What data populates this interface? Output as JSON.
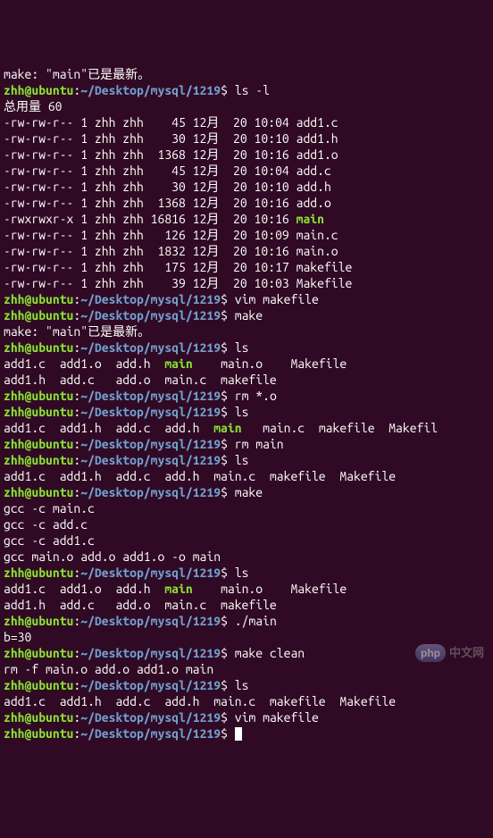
{
  "prompt": {
    "user": "zhh",
    "host": "ubuntu",
    "path": "~/Desktop/mysql/1219"
  },
  "text": {
    "make_uptodate": "make: \"main\"已是最新。",
    "total": "总用量 60"
  },
  "cmds": {
    "ls_l": "ls -l",
    "vim_makefile": "vim makefile",
    "make": "make",
    "ls": "ls",
    "rm_o": "rm *.o",
    "rm_main": "rm main",
    "run_main": "./main",
    "make_clean": "make clean"
  },
  "ls_l_rows": [
    {
      "perm": "-rw-rw-r--",
      "links": "1",
      "owner": "zhh",
      "group": "zhh",
      "size": "45",
      "month": "12月",
      "day": "20",
      "time": "10:04",
      "name": "add1.c",
      "exec": false
    },
    {
      "perm": "-rw-rw-r--",
      "links": "1",
      "owner": "zhh",
      "group": "zhh",
      "size": "30",
      "month": "12月",
      "day": "20",
      "time": "10:10",
      "name": "add1.h",
      "exec": false
    },
    {
      "perm": "-rw-rw-r--",
      "links": "1",
      "owner": "zhh",
      "group": "zhh",
      "size": "1368",
      "month": "12月",
      "day": "20",
      "time": "10:16",
      "name": "add1.o",
      "exec": false
    },
    {
      "perm": "-rw-rw-r--",
      "links": "1",
      "owner": "zhh",
      "group": "zhh",
      "size": "45",
      "month": "12月",
      "day": "20",
      "time": "10:04",
      "name": "add.c",
      "exec": false
    },
    {
      "perm": "-rw-rw-r--",
      "links": "1",
      "owner": "zhh",
      "group": "zhh",
      "size": "30",
      "month": "12月",
      "day": "20",
      "time": "10:10",
      "name": "add.h",
      "exec": false
    },
    {
      "perm": "-rw-rw-r--",
      "links": "1",
      "owner": "zhh",
      "group": "zhh",
      "size": "1368",
      "month": "12月",
      "day": "20",
      "time": "10:16",
      "name": "add.o",
      "exec": false
    },
    {
      "perm": "-rwxrwxr-x",
      "links": "1",
      "owner": "zhh",
      "group": "zhh",
      "size": "16816",
      "month": "12月",
      "day": "20",
      "time": "10:16",
      "name": "main",
      "exec": true
    },
    {
      "perm": "-rw-rw-r--",
      "links": "1",
      "owner": "zhh",
      "group": "zhh",
      "size": "126",
      "month": "12月",
      "day": "20",
      "time": "10:09",
      "name": "main.c",
      "exec": false
    },
    {
      "perm": "-rw-rw-r--",
      "links": "1",
      "owner": "zhh",
      "group": "zhh",
      "size": "1832",
      "month": "12月",
      "day": "20",
      "time": "10:16",
      "name": "main.o",
      "exec": false
    },
    {
      "perm": "-rw-rw-r--",
      "links": "1",
      "owner": "zhh",
      "group": "zhh",
      "size": "175",
      "month": "12月",
      "day": "20",
      "time": "10:17",
      "name": "makefile",
      "exec": false
    },
    {
      "perm": "-rw-rw-r--",
      "links": "1",
      "owner": "zhh",
      "group": "zhh",
      "size": "39",
      "month": "12月",
      "day": "20",
      "time": "10:03",
      "name": "Makefile",
      "exec": false
    }
  ],
  "ls1_lines": [
    [
      {
        "t": "add1.c  add1.o  add.h  "
      },
      {
        "t": "main",
        "exec": true
      },
      {
        "t": "    main.o    Makefile"
      }
    ],
    [
      {
        "t": "add1.h  add.c   add.o  main.c  makefile"
      }
    ]
  ],
  "ls2_lines": [
    [
      {
        "t": "add1.c  add1.h  add.c  add.h  "
      },
      {
        "t": "main",
        "exec": true
      },
      {
        "t": "   main.c  makefile  Makefil"
      }
    ]
  ],
  "ls3_lines": [
    [
      {
        "t": "add1.c  add1.h  add.c  add.h  main.c  makefile  Makefile"
      }
    ]
  ],
  "gcc_lines": [
    "gcc -c main.c",
    "gcc -c add.c",
    "gcc -c add1.c",
    "gcc main.o add.o add1.o -o main"
  ],
  "ls4_lines": [
    [
      {
        "t": "add1.c  add1.o  add.h  "
      },
      {
        "t": "main",
        "exec": true
      },
      {
        "t": "    main.o    Makefile"
      }
    ],
    [
      {
        "t": "add1.h  add.c   add.o  main.c  makefile"
      }
    ]
  ],
  "run_output": "b=30",
  "clean_output": "rm -f main.o add.o add1.o main",
  "ls5_lines": [
    [
      {
        "t": "add1.c  add1.h  add.c  add.h  main.c  makefile  Makefile"
      }
    ]
  ],
  "watermark": "中文网"
}
